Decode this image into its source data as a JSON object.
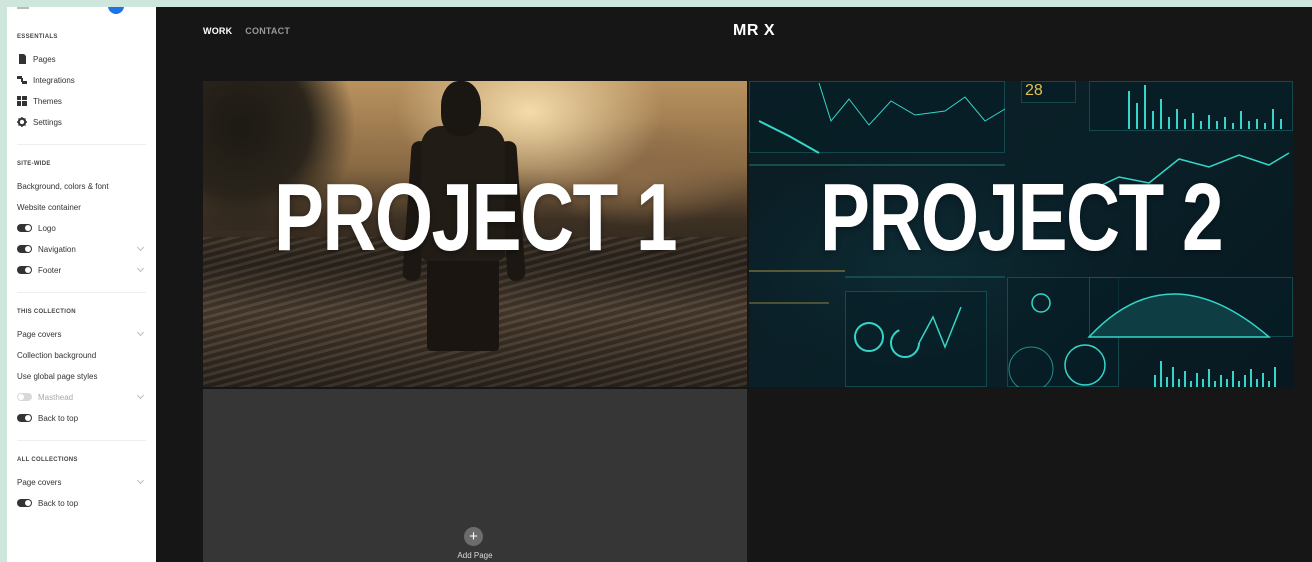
{
  "sidebar": {
    "sections": [
      {
        "title": "ESSENTIALS",
        "items": [
          {
            "label": "Pages",
            "icon": "page-icon"
          },
          {
            "label": "Integrations",
            "icon": "integrations-icon"
          },
          {
            "label": "Themes",
            "icon": "themes-icon"
          },
          {
            "label": "Settings",
            "icon": "gear-icon"
          }
        ]
      },
      {
        "title": "SITE-WIDE",
        "items": [
          {
            "label": "Background, colors & font"
          },
          {
            "label": "Website container"
          },
          {
            "label": "Logo",
            "toggle": "on"
          },
          {
            "label": "Navigation",
            "toggle": "on",
            "chevron": true
          },
          {
            "label": "Footer",
            "toggle": "on",
            "chevron": true
          }
        ]
      },
      {
        "title": "THIS COLLECTION",
        "items": [
          {
            "label": "Page covers",
            "chevron": true
          },
          {
            "label": "Collection background"
          },
          {
            "label": "Use global page styles"
          },
          {
            "label": "Masthead",
            "toggle": "off",
            "chevron": true,
            "disabled": true
          },
          {
            "label": "Back to top",
            "toggle": "on"
          }
        ]
      },
      {
        "title": "ALL COLLECTIONS",
        "items": [
          {
            "label": "Page covers",
            "chevron": true
          },
          {
            "label": "Back to top",
            "toggle": "on"
          }
        ]
      }
    ]
  },
  "site": {
    "nav": {
      "work": "WORK",
      "contact": "CONTACT"
    },
    "brand": "MR X"
  },
  "projects": [
    {
      "title": "PROJECT 1"
    },
    {
      "title": "PROJECT 2"
    }
  ],
  "add_page": {
    "icon": "plus-icon",
    "label": "Add Page"
  },
  "colors": {
    "accent": "#1e73e8",
    "canvas": "#161616",
    "hud": "#35d6c9"
  }
}
